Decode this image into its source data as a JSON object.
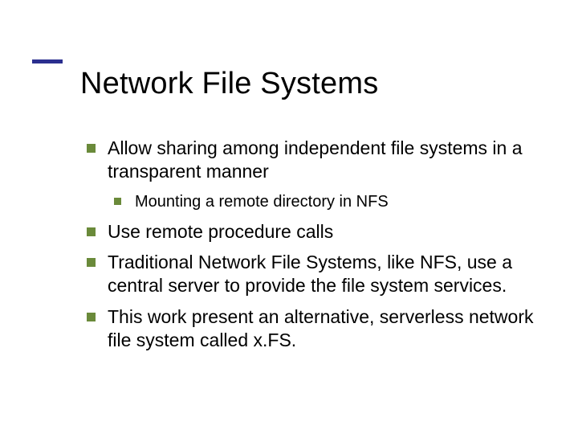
{
  "title": "Network File Systems",
  "items": [
    {
      "level": 1,
      "text": "Allow sharing among independent file systems in a transparent manner"
    },
    {
      "level": 2,
      "text": "Mounting a remote directory in NFS"
    },
    {
      "level": 1,
      "text": "Use remote procedure calls"
    },
    {
      "level": 1,
      "text": "Traditional Network File Systems, like NFS, use a central server to provide the file system services."
    },
    {
      "level": 1,
      "text": "This work present an alternative, serverless network file system called x.FS."
    }
  ]
}
